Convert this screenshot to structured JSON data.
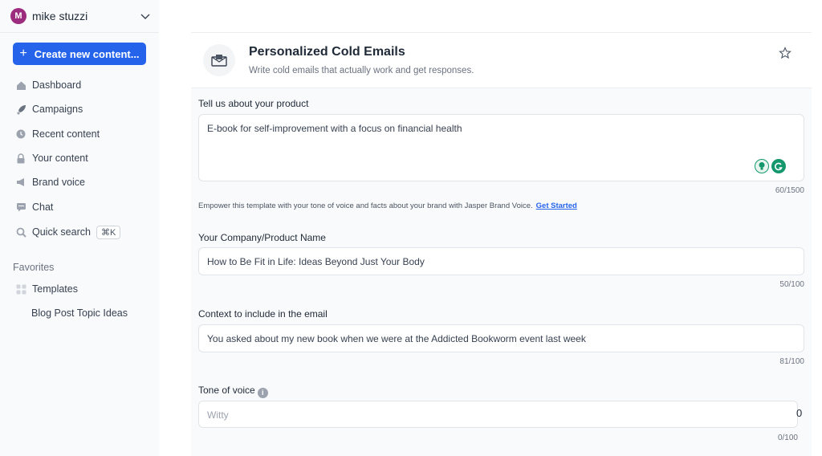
{
  "user": {
    "initial": "M",
    "name": "mike stuzzi"
  },
  "create_button": {
    "label": "Create new content..."
  },
  "nav": {
    "dashboard": "Dashboard",
    "campaigns": "Campaigns",
    "recent": "Recent content",
    "your_content": "Your content",
    "brand_voice": "Brand voice",
    "chat": "Chat",
    "quick_search": "Quick search",
    "quick_search_shortcut": "⌘K"
  },
  "favorites": {
    "title": "Favorites",
    "templates": "Templates",
    "sub_item": "Blog Post Topic Ideas"
  },
  "template": {
    "title": "Personalized Cold Emails",
    "subtitle": "Write cold emails that actually work and get responses."
  },
  "form": {
    "product": {
      "label": "Tell us about your product",
      "value": "E-book for self-improvement with a focus on financial health",
      "counter": "60/1500"
    },
    "helper": {
      "text": "Empower this template with your tone of voice and facts about your brand with Jasper Brand Voice.",
      "link": "Get Started"
    },
    "company": {
      "label": "Your Company/Product Name",
      "value": "How to Be Fit in Life: Ideas Beyond Just Your Body",
      "counter": "50/100"
    },
    "context": {
      "label": "Context to include in the email",
      "value": "You asked about my new book when we were at the Addicted Bookworm event last week",
      "counter": "81/100"
    },
    "tone": {
      "label": "Tone of voice",
      "info": "i",
      "placeholder": "Witty",
      "counter": "0/100",
      "edge_text": "0"
    }
  },
  "colors": {
    "accent": "#2563eb",
    "avatar": "#9c2d7e",
    "grammarly": "#14976c"
  }
}
